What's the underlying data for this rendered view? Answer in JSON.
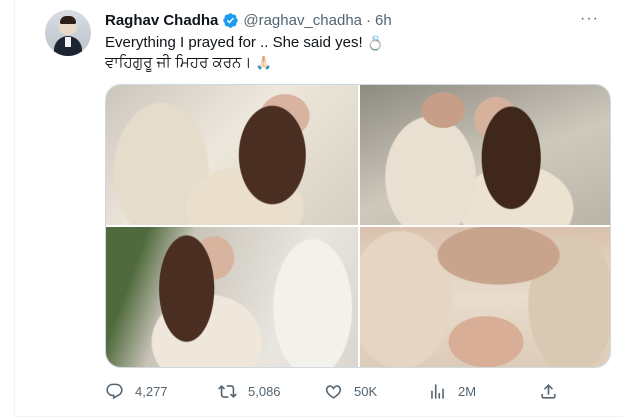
{
  "tweet": {
    "author_name": "Raghav Chadha",
    "handle": "@raghav_chadha",
    "separator": "·",
    "time": "6h",
    "more_label": "···",
    "text_line1": "Everything I prayed for .. She said yes!",
    "text_line2": "ਵਾਹਿਗੁਰੂ ਜੀ ਮਿਹਰ ਕਰਨ।",
    "emoji_ring": "💍",
    "emoji_pray": "🙏🏻"
  },
  "stats": {
    "replies": "4,277",
    "retweets": "5,086",
    "likes": "50K",
    "views": "2M"
  },
  "colors": {
    "verified": "#1d9bf0",
    "secondary_text": "#536471",
    "primary_text": "#0f1419"
  },
  "icons": [
    "verified-badge-icon",
    "more-icon",
    "reply-icon",
    "retweet-icon",
    "like-icon",
    "views-icon",
    "share-icon"
  ]
}
